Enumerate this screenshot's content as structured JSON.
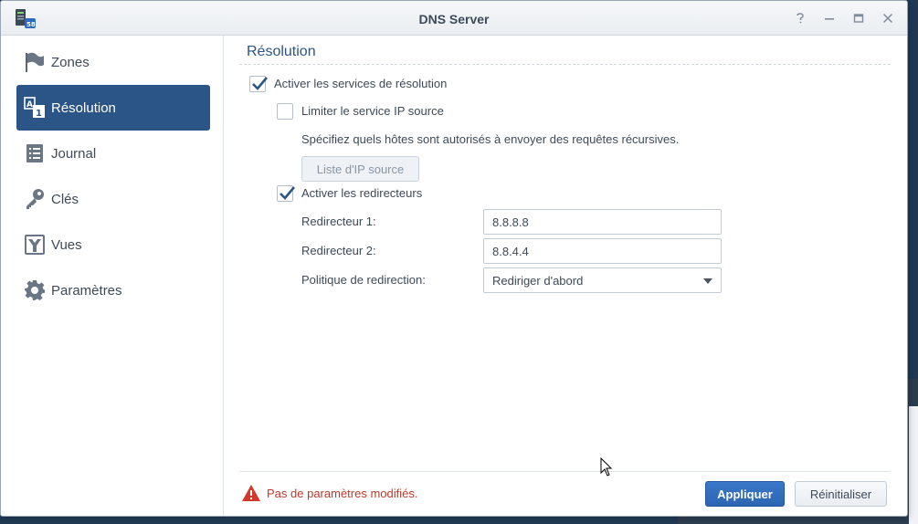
{
  "window": {
    "title": "DNS Server"
  },
  "controls": {
    "help": "help-icon",
    "minimize": "minimize-icon",
    "maximize": "maximize-icon",
    "close": "close-icon"
  },
  "sidebar": {
    "items": [
      {
        "label": "Zones",
        "icon": "flag-icon"
      },
      {
        "label": "Résolution",
        "icon": "resolution-icon",
        "active": true
      },
      {
        "label": "Journal",
        "icon": "log-icon"
      },
      {
        "label": "Clés",
        "icon": "key-icon"
      },
      {
        "label": "Vues",
        "icon": "views-icon"
      },
      {
        "label": "Paramètres",
        "icon": "gear-icon"
      }
    ]
  },
  "main": {
    "section_title": "Résolution",
    "enable_resolution": {
      "label": "Activer les services de résolution",
      "checked": true
    },
    "limit_source": {
      "label": "Limiter le service IP source",
      "checked": false
    },
    "limit_hint": "Spécifiez quels hôtes sont autorisés à envoyer des requêtes récursives.",
    "source_list_button": "Liste d'IP source",
    "enable_forwarders": {
      "label": "Activer les redirecteurs",
      "checked": true
    },
    "forwarder1": {
      "label": "Redirecteur 1:",
      "value": "8.8.8.8"
    },
    "forwarder2": {
      "label": "Redirecteur 2:",
      "value": "8.8.4.4"
    },
    "policy": {
      "label": "Politique de redirection:",
      "value": "Rediriger d'abord"
    }
  },
  "footer": {
    "status": "Pas de paramètres modifiés.",
    "apply": "Appliquer",
    "reset": "Réinitialiser"
  },
  "colors": {
    "accent": "#2b5587",
    "primary_button": "#2f6bbb",
    "warning": "#c0392b"
  }
}
